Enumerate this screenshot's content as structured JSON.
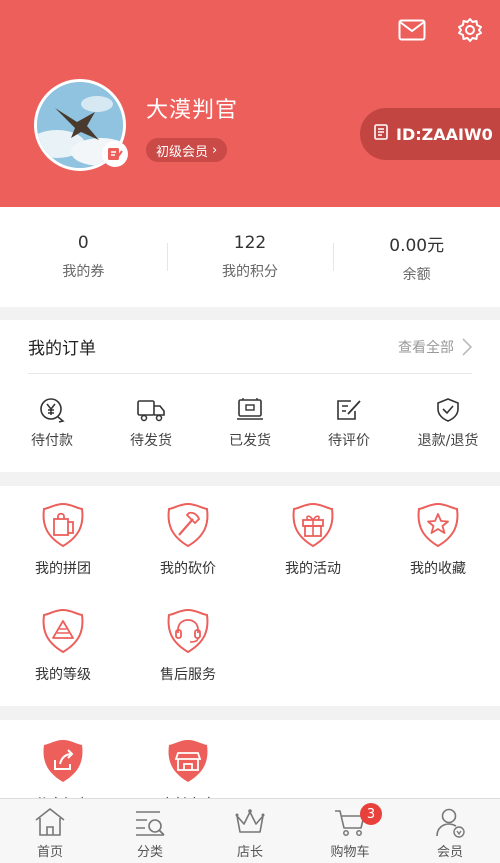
{
  "header": {
    "username": "大漠判官",
    "level_label": "初级会员",
    "id_label": "ID:ZAAIW0",
    "icons": [
      "mail-icon",
      "settings-gear-icon"
    ]
  },
  "stats": [
    {
      "value": "0",
      "label": "我的券"
    },
    {
      "value": "122",
      "label": "我的积分"
    },
    {
      "value": "0.00元",
      "label": "余额"
    }
  ],
  "orders": {
    "title": "我的订单",
    "view_all": "查看全部",
    "items": [
      {
        "label": "待付款",
        "icon": "yen-payment-icon"
      },
      {
        "label": "待发货",
        "icon": "truck-icon"
      },
      {
        "label": "已发货",
        "icon": "package-icon"
      },
      {
        "label": "待评价",
        "icon": "review-edit-icon"
      },
      {
        "label": "退款/退货",
        "icon": "shield-check-icon"
      }
    ]
  },
  "tools": [
    {
      "label": "我的拼团",
      "icon": "shopping-bag-icon"
    },
    {
      "label": "我的砍价",
      "icon": "axe-icon"
    },
    {
      "label": "我的活动",
      "icon": "gift-icon"
    },
    {
      "label": "我的收藏",
      "icon": "star-icon"
    },
    {
      "label": "我的等级",
      "icon": "level-triangle-icon"
    },
    {
      "label": "售后服务",
      "icon": "headset-icon"
    }
  ],
  "shortcuts": [
    {
      "label": "分享好友",
      "icon": "share-icon"
    },
    {
      "label": "店长专享",
      "icon": "store-icon"
    }
  ],
  "tabbar": {
    "items": [
      {
        "label": "首页",
        "icon": "home-icon"
      },
      {
        "label": "分类",
        "icon": "category-search-icon"
      },
      {
        "label": "店长",
        "icon": "crown-icon"
      },
      {
        "label": "购物车",
        "icon": "cart-icon"
      },
      {
        "label": "会员",
        "icon": "member-icon"
      }
    ],
    "cart_count": "3"
  },
  "colors": {
    "brand": "#ec5f5b",
    "brand_dark": "#c24541",
    "badge": "#e8413c"
  }
}
